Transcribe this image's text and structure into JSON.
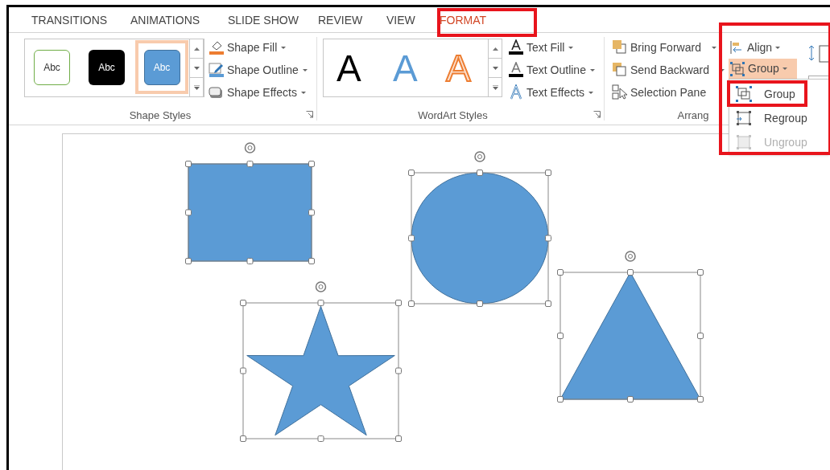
{
  "tabs": [
    {
      "label": "TRANSITIONS",
      "selected": false,
      "marked": false
    },
    {
      "label": "ANIMATIONS",
      "selected": false,
      "marked": false
    },
    {
      "label": "SLIDE SHOW",
      "selected": false,
      "marked": false
    },
    {
      "label": "REVIEW",
      "selected": false,
      "marked": false
    },
    {
      "label": "VIEW",
      "selected": false,
      "marked": false
    },
    {
      "label": "FORMAT",
      "selected": true,
      "marked": true
    }
  ],
  "shape_styles": {
    "gallery": [
      {
        "label": "Abc",
        "kind": "outline",
        "selected": false
      },
      {
        "label": "Abc",
        "kind": "dark",
        "selected": false
      },
      {
        "label": "Abc",
        "kind": "blue",
        "selected": true
      }
    ],
    "commands": [
      {
        "label": "Shape Fill",
        "kind": "fill"
      },
      {
        "label": "Shape Outline",
        "kind": "outline"
      },
      {
        "label": "Shape Effects",
        "kind": "effects"
      }
    ],
    "title": "Shape Styles"
  },
  "wordart_styles": {
    "gallery": [
      {
        "label": "A",
        "kind": "black"
      },
      {
        "label": "A",
        "kind": "blue"
      },
      {
        "label": "A",
        "kind": "orange"
      }
    ],
    "commands": [
      {
        "label": "Text Fill",
        "kind": "fill"
      },
      {
        "label": "Text Outline",
        "kind": "outline"
      },
      {
        "label": "Text Effects",
        "kind": "effects"
      }
    ],
    "title": "WordArt Styles"
  },
  "arrange": {
    "commands": [
      {
        "label": "Bring Forward",
        "kind": "forward"
      },
      {
        "label": "Send Backward",
        "kind": "backward"
      },
      {
        "label": "Selection Pane",
        "kind": "pane"
      }
    ],
    "title": "Arrang",
    "align": {
      "label": "Align"
    },
    "group": {
      "label": "Group",
      "expanded": true
    },
    "marked": true
  },
  "group_menu": [
    {
      "label": "Group",
      "kind": "group",
      "disabled": false,
      "marked": true
    },
    {
      "label": "Regroup",
      "kind": "regroup",
      "disabled": false,
      "marked": false
    },
    {
      "label": "Ungroup",
      "kind": "ungroup",
      "disabled": true,
      "marked": false
    }
  ],
  "slide_shapes": [
    {
      "kind": "rectangle",
      "selected": true
    },
    {
      "kind": "ellipse",
      "selected": true
    },
    {
      "kind": "star",
      "selected": true
    },
    {
      "kind": "triangle",
      "selected": true
    }
  ]
}
